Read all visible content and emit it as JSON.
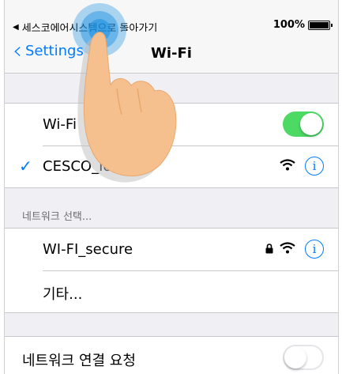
{
  "status_bar": {
    "back_app": "세스코에어시스템으로 돌아가기",
    "battery_text": "100%"
  },
  "nav": {
    "back_label": "Settings",
    "title": "Wi-Fi"
  },
  "wifi_section": {
    "wifi_label": "Wi-Fi",
    "wifi_enabled": true,
    "connected_network": "CESCO_IoT"
  },
  "networks_section": {
    "header": "네트워크 선택...",
    "networks": [
      {
        "name": "WI-FI_secure",
        "locked": true
      }
    ],
    "other_label": "기타..."
  },
  "ask_section": {
    "label": "네트워크 연결 요청",
    "enabled": false
  },
  "colors": {
    "accent": "#007aff",
    "toggle_on": "#4cd964",
    "background": "#efeff4"
  }
}
